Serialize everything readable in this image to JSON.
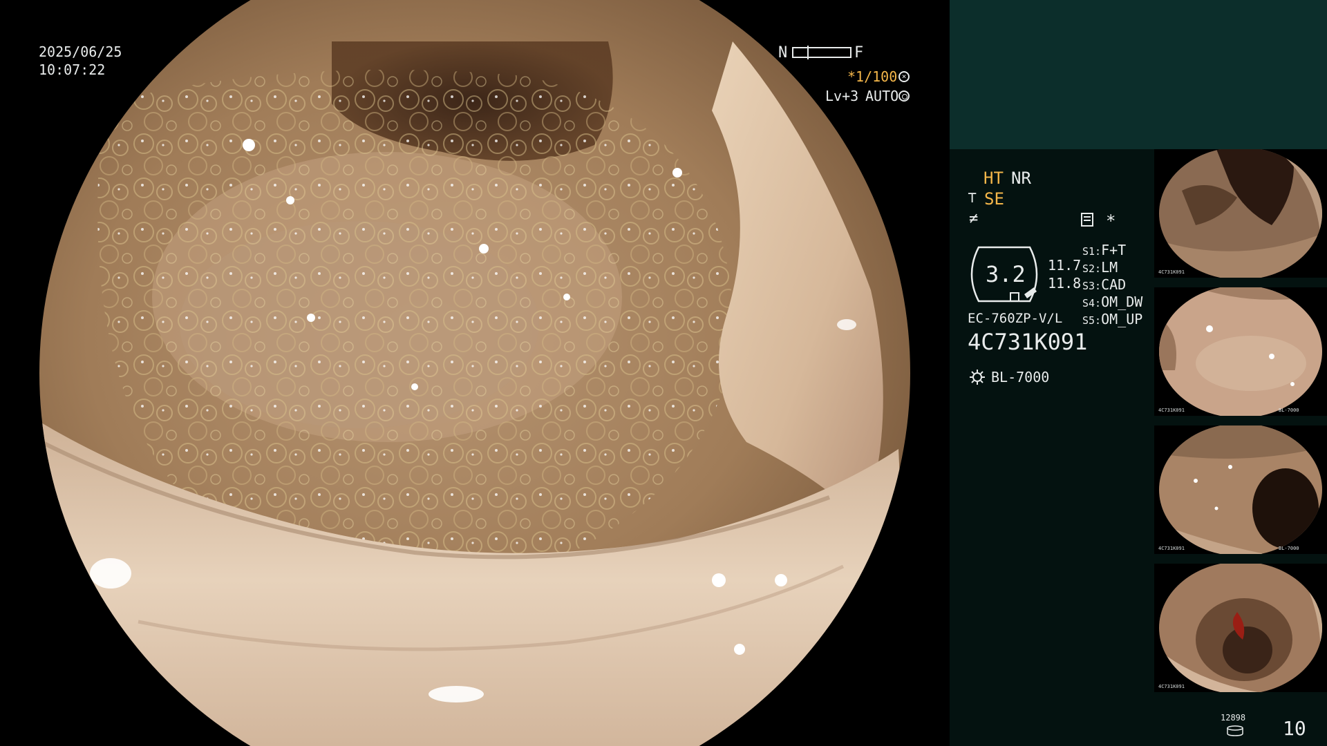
{
  "overlay": {
    "date": "2025/06/25",
    "time": "10:07:22",
    "nf_near": "N",
    "nf_far": "F",
    "shutter": "*1/100",
    "level": "Lv+3",
    "iris_mode": "AUTO"
  },
  "panel": {
    "mode_ht": "HT",
    "mode_nr": "NR",
    "se_label": "SE",
    "zoom_value": "3.2",
    "value_top": "11.7",
    "value_bottom": "11.8",
    "presets": [
      {
        "key": "S1:",
        "value": "F+T"
      },
      {
        "key": "S2:",
        "value": "LM"
      },
      {
        "key": "S3:",
        "value": "CAD"
      },
      {
        "key": "S4:",
        "value": "OM_DW"
      },
      {
        "key": "S5:",
        "value": "OM_UP"
      }
    ],
    "scope_model": "EC-760ZP-V/L",
    "serial": "4C731K091",
    "light_source": "BL-7000",
    "storage_count": "12898",
    "image_count": "10",
    "asterisk": "*"
  },
  "thumbnails": [
    {
      "id": "capture-1",
      "tone": "#8a6a52"
    },
    {
      "id": "capture-2",
      "tone": "#c9a48a"
    },
    {
      "id": "capture-3",
      "tone": "#a98466"
    },
    {
      "id": "capture-4",
      "tone": "#a07a5e"
    }
  ],
  "thumb_text": {
    "serial": "4C731K091",
    "light": "BL-7000"
  },
  "colors": {
    "panel_bg": "#041210",
    "panel_top": "#0c2e2b",
    "accent_orange": "#f5b74a",
    "text": "#e9ecec"
  }
}
